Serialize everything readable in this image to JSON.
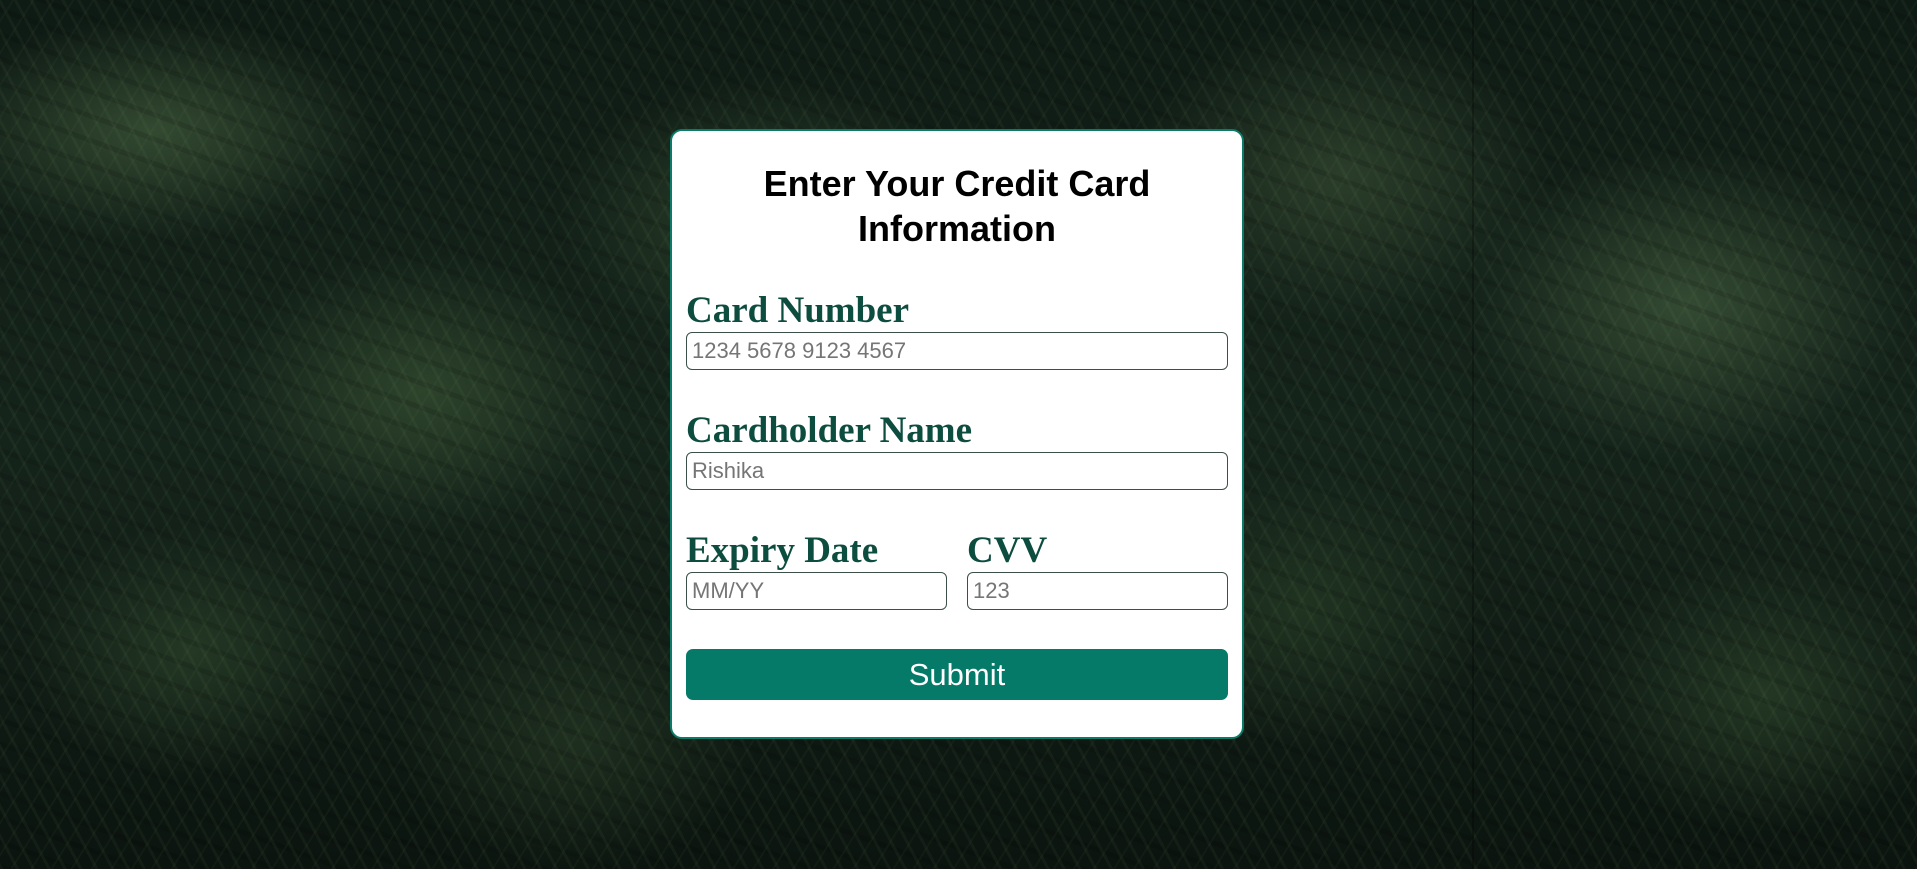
{
  "form": {
    "title": "Enter Your Credit Card Information",
    "card_number": {
      "label": "Card Number",
      "placeholder": "1234 5678 9123 4567"
    },
    "cardholder_name": {
      "label": "Cardholder Name",
      "placeholder": "Rishika"
    },
    "expiry_date": {
      "label": "Expiry Date",
      "placeholder": "MM/YY"
    },
    "cvv": {
      "label": "CVV",
      "placeholder": "123"
    },
    "submit_label": "Submit"
  },
  "colors": {
    "accent": "#067a68",
    "label": "#0d4d3f",
    "card_border": "#0b7a68",
    "background": "#0e1a14"
  }
}
